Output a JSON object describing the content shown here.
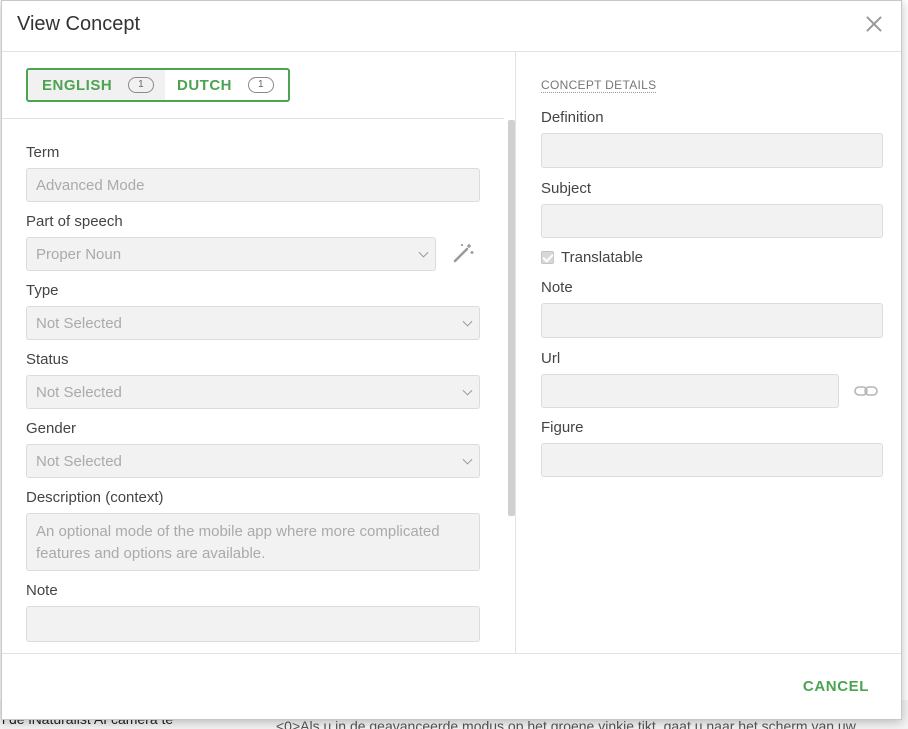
{
  "background": {
    "left_text": "l de iNaturalist AI camera te",
    "right_text": "<0>Als u in de geavanceerde modus op het groene vinkje tikt, gaat u naar het scherm van uw"
  },
  "dialog": {
    "title": "View Concept",
    "close_icon": "close-icon"
  },
  "language_tabs": [
    {
      "label": "ENGLISH",
      "count": "1",
      "active": true
    },
    {
      "label": "DUTCH",
      "count": "1",
      "active": false
    }
  ],
  "left_fields": {
    "term": {
      "label": "Term",
      "value": "Advanced Mode"
    },
    "part_of_speech": {
      "label": "Part of speech",
      "value": "Proper Noun"
    },
    "type": {
      "label": "Type",
      "value": "Not Selected"
    },
    "status": {
      "label": "Status",
      "value": "Not Selected"
    },
    "gender": {
      "label": "Gender",
      "value": "Not Selected"
    },
    "description": {
      "label": "Description (context)",
      "value": "An optional mode of the mobile app where more complicated features and options are available."
    },
    "note": {
      "label": "Note",
      "value": ""
    }
  },
  "concept_details": {
    "heading": "CONCEPT DETAILS",
    "definition": {
      "label": "Definition",
      "value": ""
    },
    "subject": {
      "label": "Subject",
      "value": ""
    },
    "translatable": {
      "label": "Translatable",
      "checked": true
    },
    "note": {
      "label": "Note",
      "value": ""
    },
    "url": {
      "label": "Url",
      "value": ""
    },
    "figure": {
      "label": "Figure",
      "value": ""
    }
  },
  "footer": {
    "cancel_label": "CANCEL"
  },
  "colors": {
    "accent": "#4ca352",
    "field_bg": "#f2f2f2",
    "border": "#dcdcdc"
  }
}
